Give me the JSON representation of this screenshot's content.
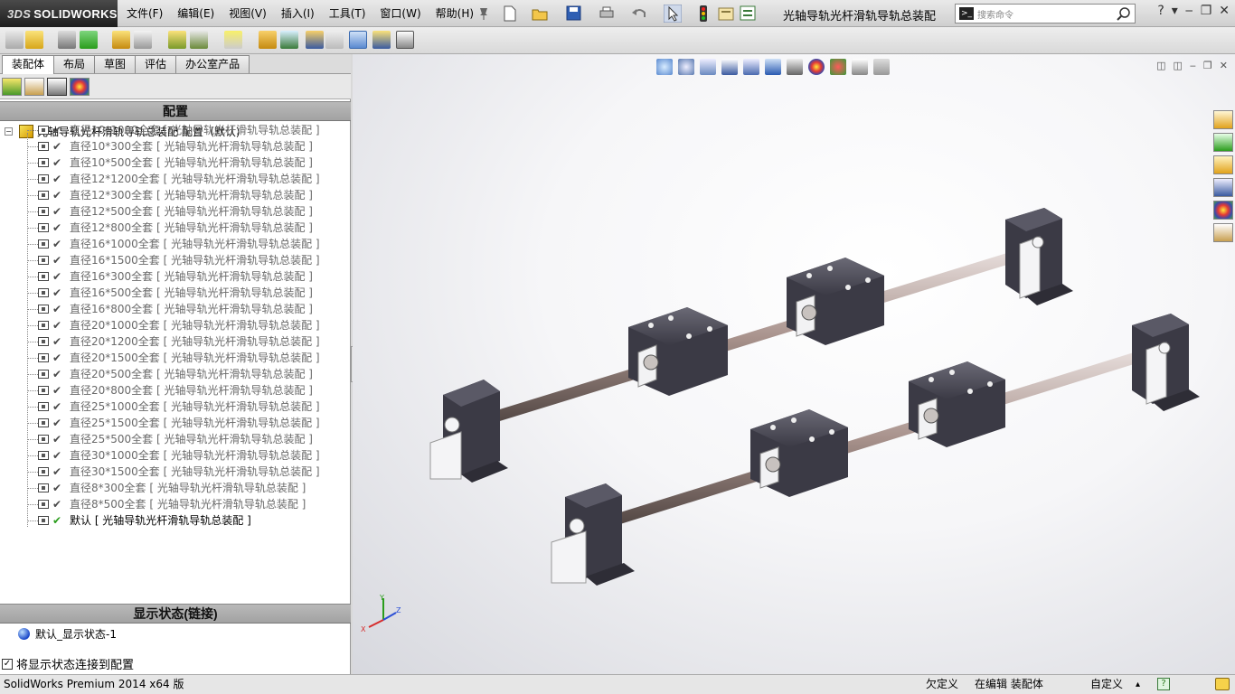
{
  "app": {
    "brand_prefix": "3DS",
    "brand": "SOLIDWORKS",
    "doc_title": "光轴导轨光杆滑轨导轨总装配"
  },
  "menu": [
    "文件(F)",
    "编辑(E)",
    "视图(V)",
    "插入(I)",
    "工具(T)",
    "窗口(W)",
    "帮助(H)"
  ],
  "search": {
    "placeholder": "搜索命令"
  },
  "tabs": [
    "装配体",
    "布局",
    "草图",
    "评估",
    "办公室产品"
  ],
  "config_panel": {
    "header": "配置",
    "root_label": "光轴导轨光杆滑轨导轨总装配 配置（默认)",
    "items": [
      "直径10*1000全套 [ 光轴导轨光杆滑轨导轨总装配 ]",
      "直径10*300全套 [ 光轴导轨光杆滑轨导轨总装配 ]",
      "直径10*500全套 [ 光轴导轨光杆滑轨导轨总装配 ]",
      "直径12*1200全套 [ 光轴导轨光杆滑轨导轨总装配 ]",
      "直径12*300全套 [ 光轴导轨光杆滑轨导轨总装配 ]",
      "直径12*500全套 [ 光轴导轨光杆滑轨导轨总装配 ]",
      "直径12*800全套 [ 光轴导轨光杆滑轨导轨总装配 ]",
      "直径16*1000全套 [ 光轴导轨光杆滑轨导轨总装配 ]",
      "直径16*1500全套 [ 光轴导轨光杆滑轨导轨总装配 ]",
      "直径16*300全套 [ 光轴导轨光杆滑轨导轨总装配 ]",
      "直径16*500全套 [ 光轴导轨光杆滑轨导轨总装配 ]",
      "直径16*800全套 [ 光轴导轨光杆滑轨导轨总装配 ]",
      "直径20*1000全套 [ 光轴导轨光杆滑轨导轨总装配 ]",
      "直径20*1200全套 [ 光轴导轨光杆滑轨导轨总装配 ]",
      "直径20*1500全套 [ 光轴导轨光杆滑轨导轨总装配 ]",
      "直径20*500全套 [ 光轴导轨光杆滑轨导轨总装配 ]",
      "直径20*800全套 [ 光轴导轨光杆滑轨导轨总装配 ]",
      "直径25*1000全套 [ 光轴导轨光杆滑轨导轨总装配 ]",
      "直径25*1500全套 [ 光轴导轨光杆滑轨导轨总装配 ]",
      "直径25*500全套 [ 光轴导轨光杆滑轨导轨总装配 ]",
      "直径30*1000全套 [ 光轴导轨光杆滑轨导轨总装配 ]",
      "直径30*1500全套 [ 光轴导轨光杆滑轨导轨总装配 ]",
      "直径8*300全套 [ 光轴导轨光杆滑轨导轨总装配 ]",
      "直径8*500全套 [ 光轴导轨光杆滑轨导轨总装配 ]",
      "默认 [ 光轴导轨光杆滑轨导轨总装配 ]"
    ]
  },
  "display_panel": {
    "header": "显示状态(链接)",
    "item": "默认_显示状态-1",
    "link_checkbox": "将显示状态连接到配置"
  },
  "triad": {
    "x": "X",
    "y": "Y",
    "z": "Z"
  },
  "status": {
    "version": "SolidWorks Premium 2014 x64 版",
    "defined": "欠定义",
    "editing": "在编辑 装配体",
    "custom": "自定义"
  },
  "colors": {
    "check_active": "#2a9d1c",
    "panel_header": "#aeaeae",
    "part_dark": "#3b3a45",
    "rod": "#b8a8a4"
  }
}
